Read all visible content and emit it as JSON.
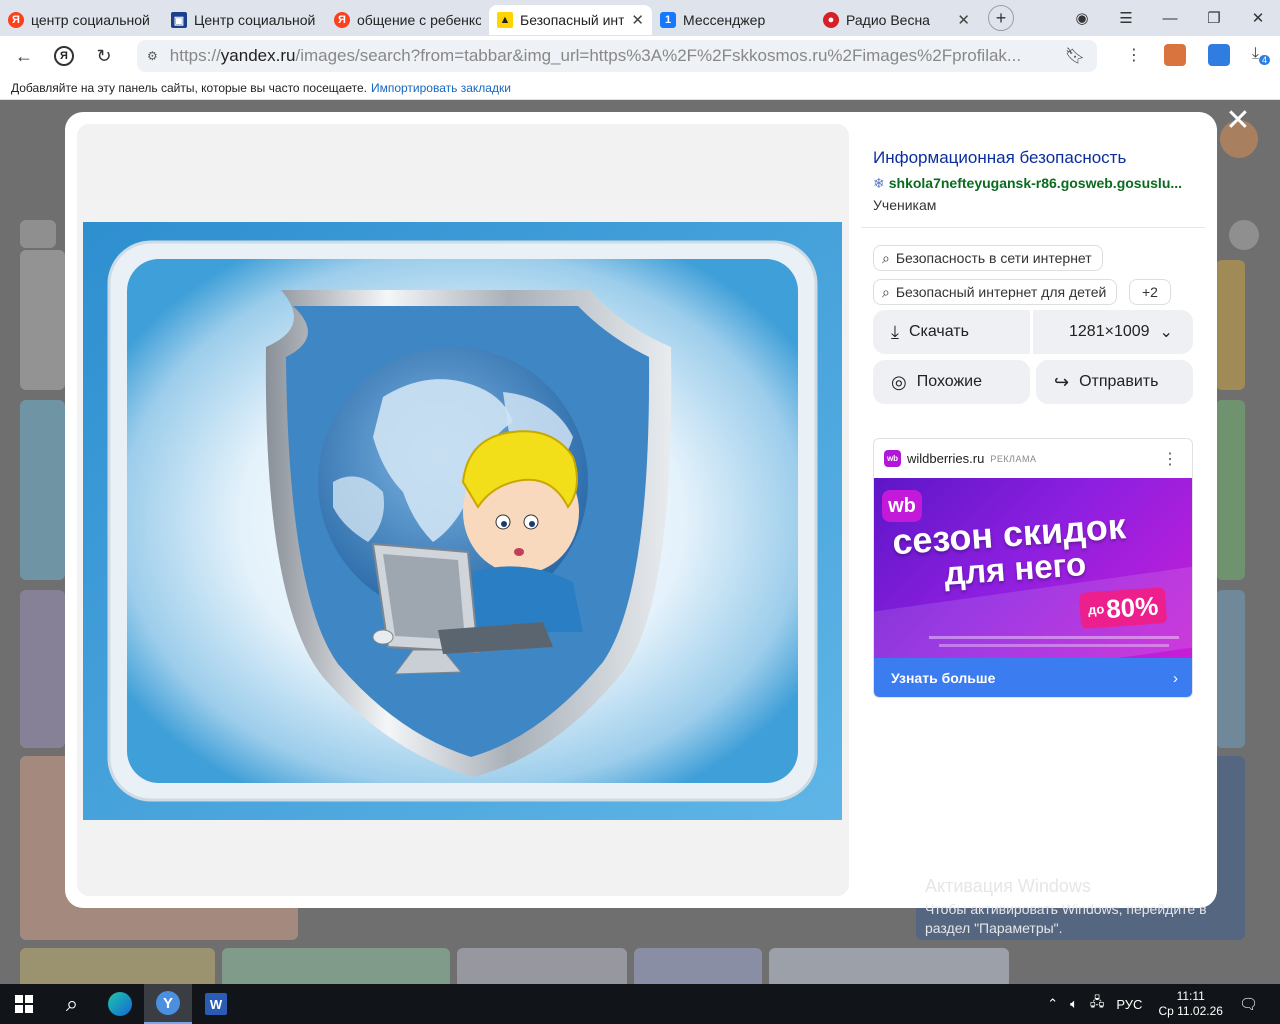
{
  "tabs": [
    {
      "title": "центр социальной",
      "favicon": "yandex-icon"
    },
    {
      "title": "Центр социальной",
      "favicon": "site-icon"
    },
    {
      "title": "общение с ребенко",
      "favicon": "yandex-icon"
    },
    {
      "title": "Безопасный инте",
      "favicon": "image-icon",
      "active": true
    },
    {
      "title": "Мессенджер",
      "favicon": "messenger-icon"
    },
    {
      "title": "Радио Весна",
      "favicon": "radio-icon"
    }
  ],
  "address": {
    "prefix": "https://",
    "host": "yandex.ru",
    "rest": "/images/search?from=tabbar&img_url=https%3A%2F%2Fskkosmos.ru%2Fimages%2Fprofilak..."
  },
  "downloads_badge": "4",
  "bookmarks_bar": {
    "text": "Добавляйте на эту панель сайты, которые вы часто посещаете.",
    "link": "Импортировать закладки"
  },
  "result": {
    "title": "Информационная безопасность",
    "source": "shkola7nefteyugansk-r86.gosweb.gosuslu...",
    "category": "Ученикам",
    "tags": [
      "Безопасность в сети интернет",
      "Безопасный интернет для детей"
    ],
    "more_tags": "+2",
    "download_label": "Скачать",
    "size_label": "1281×1009",
    "similar_label": "Похожие",
    "share_label": "Отправить"
  },
  "ad": {
    "site": "wildberries.ru",
    "label": "РЕКЛАМА",
    "logo_text": "wb",
    "headline_1": "сезон скидок",
    "headline_2": "для него",
    "discount_prefix": "до",
    "discount": "80%",
    "cta": "Узнать больше"
  },
  "activation": {
    "title": "Активация Windows",
    "text": "Чтобы активировать Windows, перейдите в раздел \"Параметры\"."
  },
  "taskbar": {
    "lang": "РУС",
    "time": "11:11",
    "date": "Ср 11.02.26"
  },
  "colors": {
    "accent_blue": "#3b7cf0",
    "link_blue": "#0b2d9e",
    "source_green": "#0a6b1e",
    "wb_purple": "#b017d6"
  }
}
